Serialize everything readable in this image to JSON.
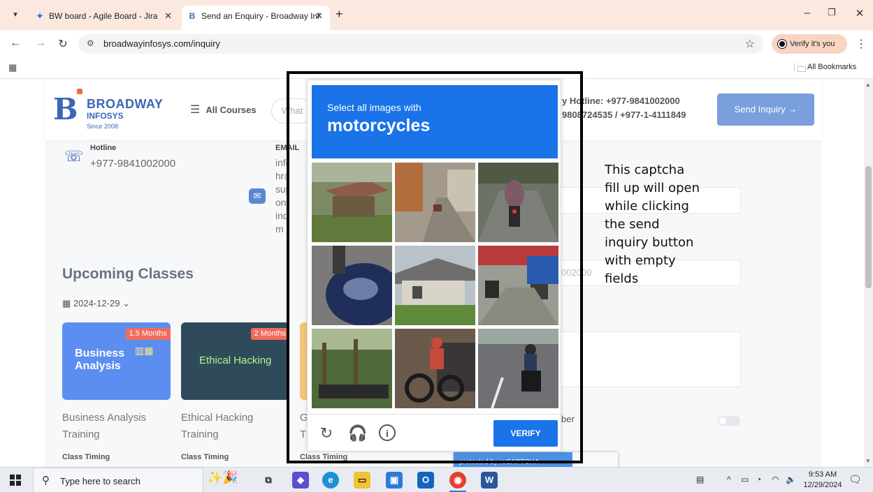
{
  "browser": {
    "tabs": [
      {
        "title": "BW board - Agile Board - Jira",
        "icon": "jira-icon"
      },
      {
        "title": "Send an Enquiry - Broadway Inf",
        "icon": "broadway-favicon"
      }
    ],
    "url": "broadwayinfosys.com/inquiry",
    "verify_chip": "Verify it's you",
    "all_bookmarks": "All Bookmarks"
  },
  "header": {
    "logo_title": "BROADWAY",
    "logo_subtitle": "INFOSYS",
    "logo_since": "Since 2008",
    "all_courses": "All Courses",
    "search_placeholder": "What",
    "hotline_line1": "y Hotline: +977-9841002000",
    "hotline_line2": "9808724535 / +977-1-4111849",
    "send_inquiry": "Send Inquiry →"
  },
  "contact": {
    "hotline_label": "Hotline",
    "hotline_number": "+977-9841002000",
    "email_label": "EMAIL",
    "email_lines": [
      "info@b",
      "hr@bro",
      "suppor",
      "on",
      "inquiry",
      "m"
    ]
  },
  "upcoming": {
    "title": "Upcoming Classes",
    "date": "2024-12-29"
  },
  "courses": [
    {
      "badge": "1.5 Months",
      "card_title": "Business Analysis",
      "name_line1": "Business Analysis",
      "name_line2": "Training",
      "timing": "Class Timing"
    },
    {
      "badge": "2 Months",
      "card_title": "Ethical Hacking",
      "name_line1": "Ethical Hacking",
      "name_line2": "Training",
      "timing": "Class Timing"
    },
    {
      "badge": "",
      "card_title": "",
      "name_line1": "G",
      "name_line2": "T",
      "timing": "Class Timing"
    }
  ],
  "form": {
    "phone_fragment": "002000",
    "label_fragment": "ber"
  },
  "recaptcha_badge": "protected by reCAPTCHA",
  "annotation": "This captcha fill up will open while clicking the send inquiry button with empty fields",
  "captcha": {
    "instruction": "Select all images with",
    "target": "motorcycles",
    "verify_label": "VERIFY",
    "tiles": [
      {
        "scene": "roadside hut with corrugated roof"
      },
      {
        "scene": "village street with shops"
      },
      {
        "scene": "rider on motorcycle from behind"
      },
      {
        "scene": "close-up of a motorcycle tank"
      },
      {
        "scene": "house with tin roof"
      },
      {
        "scene": "busy market street with motorbikes"
      },
      {
        "scene": "trees with parked motorbikes"
      },
      {
        "scene": "man on motorcycle near car"
      },
      {
        "scene": "rider on scooter on road"
      }
    ]
  },
  "taskbar": {
    "search_placeholder": "Type here to search",
    "time": "9:53 AM",
    "date": "12/29/2024"
  },
  "colors": {
    "captcha_blue": "#1a73e8",
    "brand_blue": "#3a67b8",
    "tab_strip": "#fbe8df"
  }
}
